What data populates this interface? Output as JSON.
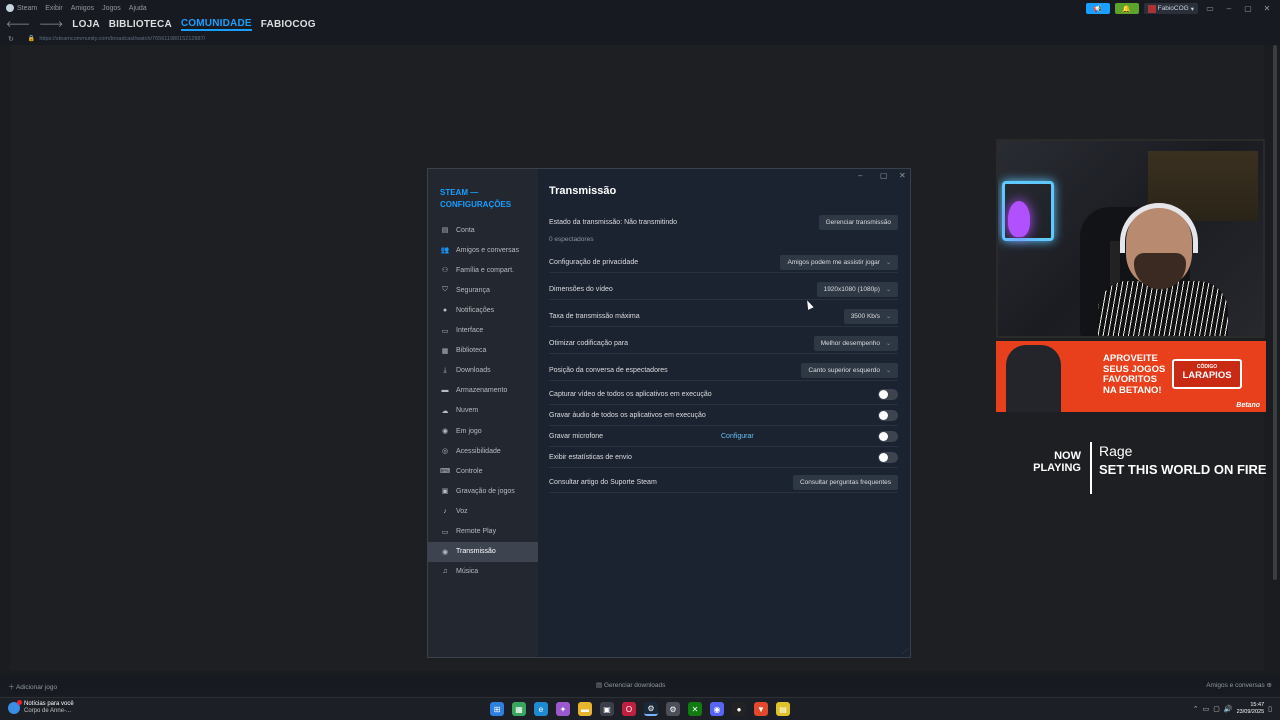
{
  "menubar": {
    "items": [
      "Steam",
      "Exibir",
      "Amigos",
      "Jogos",
      "Ajuda"
    ],
    "user": "FabioCOG"
  },
  "nav": {
    "tabs": [
      "LOJA",
      "BIBLIOTECA",
      "COMUNIDADE",
      "FABIOCOG"
    ],
    "active": "COMUNIDADE"
  },
  "url": "https://steamcommunity.com/broadcast/watch/76561198015212887/",
  "dialog": {
    "title": "STEAM — CONFIGURAÇÕES",
    "sidebar": [
      {
        "label": "Conta",
        "icon": "▤"
      },
      {
        "label": "Amigos e conversas",
        "icon": "👥"
      },
      {
        "label": "Família e compart.",
        "icon": "⚇"
      },
      {
        "label": "Segurança",
        "icon": "⛉"
      },
      {
        "label": "Notificações",
        "icon": "●"
      },
      {
        "label": "Interface",
        "icon": "▭"
      },
      {
        "label": "Biblioteca",
        "icon": "▦"
      },
      {
        "label": "Downloads",
        "icon": "⤓"
      },
      {
        "label": "Armazenamento",
        "icon": "▬"
      },
      {
        "label": "Nuvem",
        "icon": "☁"
      },
      {
        "label": "Em jogo",
        "icon": "◉"
      },
      {
        "label": "Acessibilidade",
        "icon": "◎"
      },
      {
        "label": "Controle",
        "icon": "⌨"
      },
      {
        "label": "Gravação de jogos",
        "icon": "▣"
      },
      {
        "label": "Voz",
        "icon": "♪"
      },
      {
        "label": "Remote Play",
        "icon": "▭"
      },
      {
        "label": "Transmissão",
        "icon": "◉"
      },
      {
        "label": "Música",
        "icon": "♫"
      }
    ],
    "active_item": "Transmissão",
    "main": {
      "title": "Transmissão",
      "status_label": "Estado da transmissão: Não transmitindo",
      "manage_button": "Gerenciar transmissão",
      "viewers": "0 espectadores",
      "privacy": {
        "label": "Configuração de privacidade",
        "value": "Amigos podem me assistir jogar"
      },
      "dimensions": {
        "label": "Dimensões do vídeo",
        "value": "1920x1080 (1080p)"
      },
      "bitrate": {
        "label": "Taxa de transmissão máxima",
        "value": "3500 Kb/s"
      },
      "encoding": {
        "label": "Otimizar codificação para",
        "value": "Melhor desempenho"
      },
      "chat_position": {
        "label": "Posição da conversa de espectadores",
        "value": "Canto superior esquerdo"
      },
      "capture_video": {
        "label": "Capturar vídeo de todos os aplicativos em execução"
      },
      "record_audio": {
        "label": "Gravar áudio de todos os aplicativos em execução"
      },
      "record_mic": {
        "label": "Gravar microfone",
        "link": "Configurar"
      },
      "show_stats": {
        "label": "Exibir estatísticas de envio"
      },
      "support": {
        "label": "Consultar artigo do Suporte Steam",
        "button": "Consultar perguntas frequentes"
      }
    }
  },
  "overlay": {
    "banner_text": [
      "APROVEITE",
      "SEUS JOGOS",
      "FAVORITOS",
      "NA BETANO!"
    ],
    "badge_top": "CÓDIGO",
    "badge_main": "LARAPIOS",
    "brand": "Betano",
    "now_playing": [
      "NOW",
      "PLAYING"
    ],
    "artist": "Rage",
    "song": "SET THIS WORLD ON FIRE"
  },
  "bottombar": {
    "add_game": "Adicionar jogo",
    "downloads": "Gerenciar downloads",
    "friends": "Amigos e conversas"
  },
  "taskbar": {
    "news_title": "Notícias para você",
    "news_sub": "Corpo de Anne-...",
    "time": "15:47",
    "date": "23/09/2025"
  }
}
